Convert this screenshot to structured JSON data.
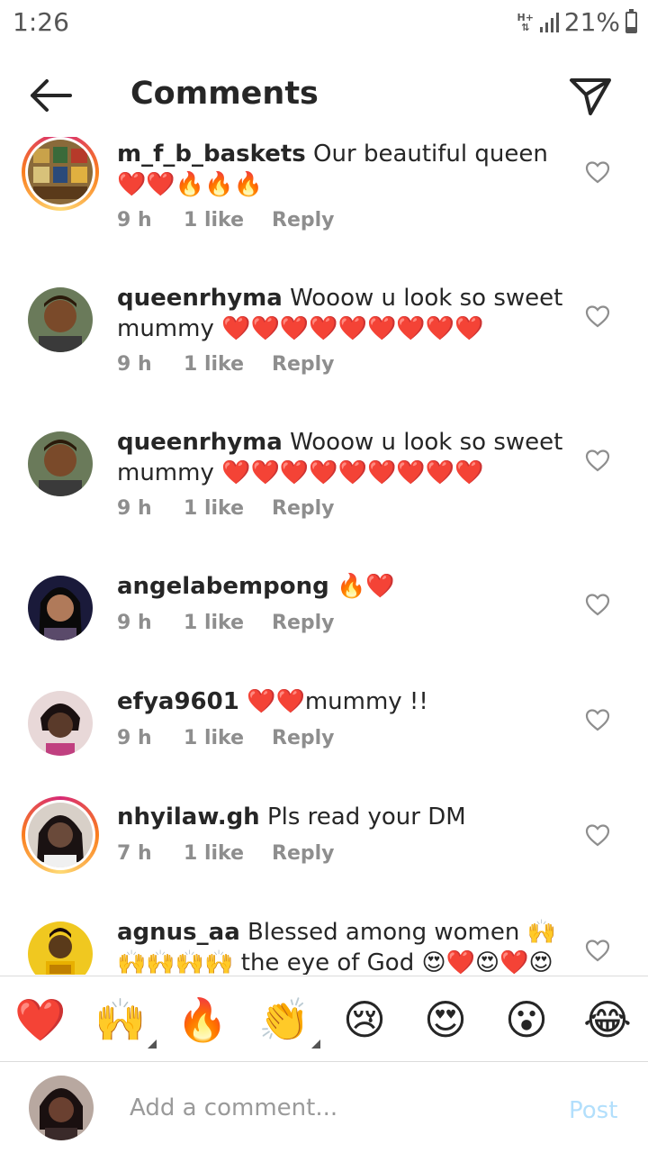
{
  "status_bar": {
    "time": "1:26",
    "network": "H+",
    "battery": "21%",
    "battery_level": 0.21
  },
  "header": {
    "title": "Comments",
    "back_icon": "arrow-left-icon",
    "send_icon": "paper-plane-icon"
  },
  "comments": [
    {
      "username": "m_f_b_baskets",
      "text": "Our  beautiful queen ❤️❤️🔥🔥🔥",
      "time": "9 h",
      "likes": "1 like",
      "reply": "Reply",
      "story_ring": true
    },
    {
      "username": "queenrhyma",
      "text": "Wooow u look so sweet mummy ❤️❤️❤️❤️❤️❤️❤️❤️❤️",
      "time": "9 h",
      "likes": "1 like",
      "reply": "Reply",
      "story_ring": false
    },
    {
      "username": "queenrhyma",
      "text": "Wooow u look so sweet mummy ❤️❤️❤️❤️❤️❤️❤️❤️❤️",
      "time": "9 h",
      "likes": "1 like",
      "reply": "Reply",
      "story_ring": false
    },
    {
      "username": "angelabempong",
      "text": "🔥❤️",
      "time": "9 h",
      "likes": "1 like",
      "reply": "Reply",
      "story_ring": false
    },
    {
      "username": "efya9601",
      "text": "❤️❤️mummy !!",
      "time": "9 h",
      "likes": "1 like",
      "reply": "Reply",
      "story_ring": false
    },
    {
      "username": "nhyilaw.gh",
      "text": "Pls read your DM",
      "time": "7 h",
      "likes": "1 like",
      "reply": "Reply",
      "story_ring": true
    },
    {
      "username": "agnus_aa",
      "text": "Blessed among women 🙌🙌🙌🙌🙌 the eye of God 😍❤️😍❤️😍❤️",
      "time": "",
      "likes": "",
      "reply": "",
      "story_ring": false
    }
  ],
  "emoji_bar": [
    "❤️",
    "🙌",
    "🔥",
    "👏",
    "😢",
    "😍",
    "😮",
    "😂"
  ],
  "composer": {
    "placeholder": "Add a comment...",
    "post_label": "Post"
  },
  "colors": {
    "text": "#262626",
    "meta": "#8e8e8e",
    "post_disabled": "#b2dffc",
    "divider": "#dbdbdb"
  }
}
